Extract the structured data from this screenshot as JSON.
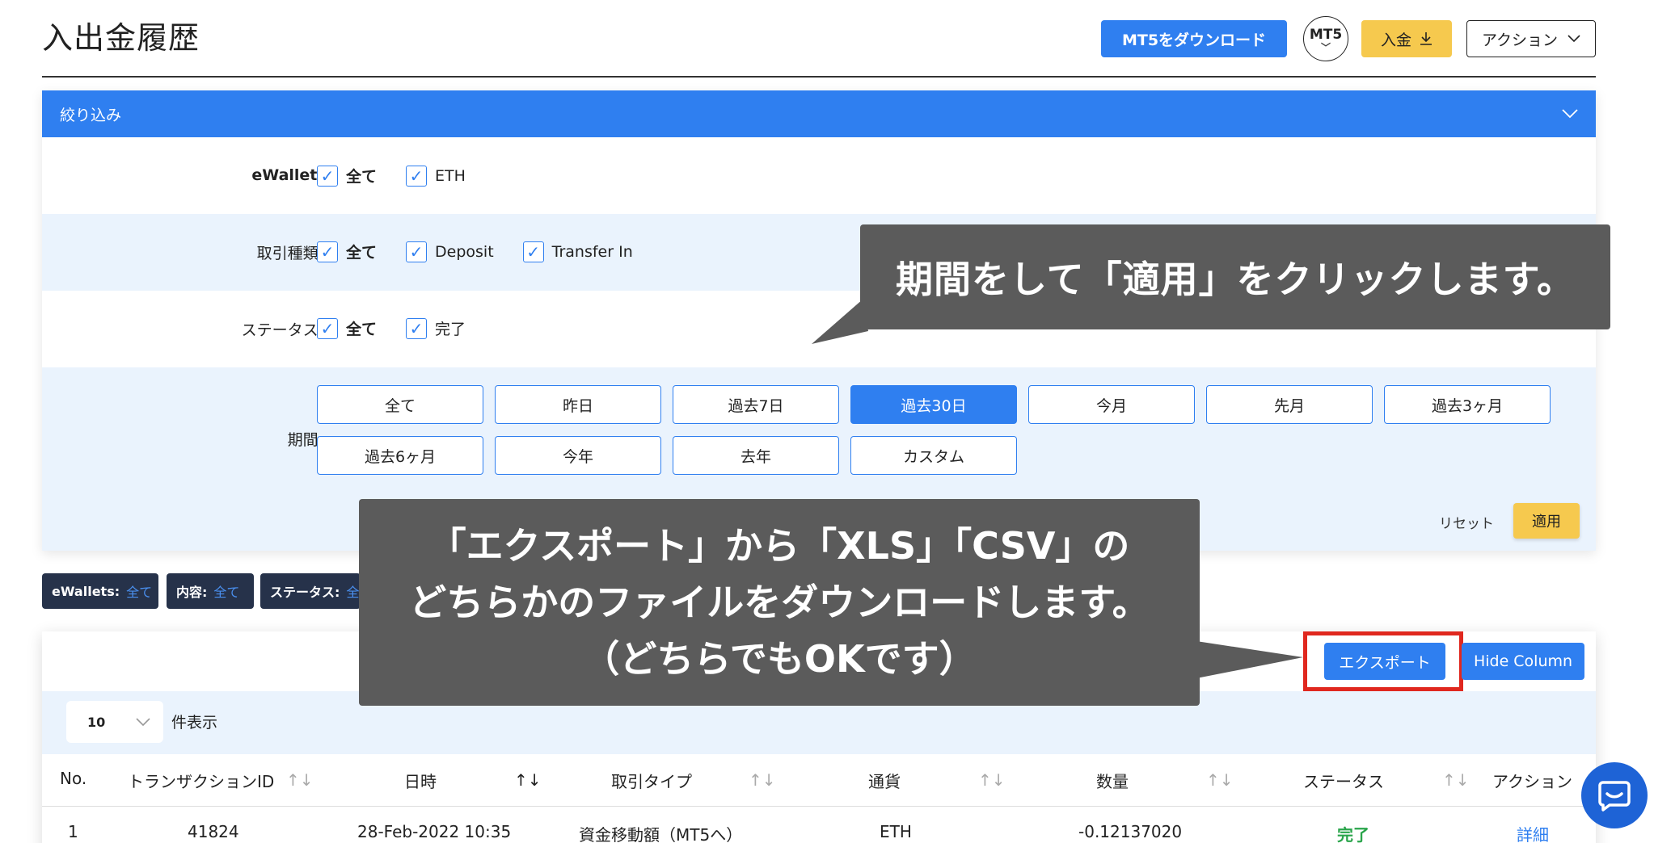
{
  "header": {
    "title": "入出金履歴",
    "mt5_download_label": "MT5をダウンロード",
    "mt5_badge": "MT5",
    "deposit_label": "入金",
    "action_label": "アクション"
  },
  "filter": {
    "heading": "絞り込み",
    "rows": {
      "ewallet": {
        "label": "eWallet:",
        "options": [
          "全て",
          "ETH"
        ]
      },
      "tx_type": {
        "label": "取引種類:",
        "options": [
          "全て",
          "Deposit",
          "Transfer In"
        ]
      },
      "status": {
        "label": "ステータス:",
        "options": [
          "全て",
          "完了"
        ]
      },
      "period": {
        "label": "期間:",
        "buttons": [
          "全て",
          "昨日",
          "過去7日",
          "過去30日",
          "今月",
          "先月",
          "過去3ヶ月",
          "過去6ヶ月",
          "今年",
          "去年",
          "カスタム"
        ],
        "selected": "過去30日"
      }
    },
    "reset_label": "リセット",
    "apply_label": "適用"
  },
  "chips": [
    {
      "key": "eWallets:",
      "value": "全て"
    },
    {
      "key": "内容:",
      "value": "全て"
    },
    {
      "key": "ステータス:",
      "value": "全"
    }
  ],
  "table": {
    "export_label": "エクスポート",
    "hide_column_label": "Hide Column",
    "page_length": "10",
    "page_length_label": "件表示",
    "columns": [
      "No.",
      "トランザクションID",
      "日時",
      "取引タイプ",
      "通貨",
      "数量",
      "ステータス",
      "アクション"
    ],
    "rows": [
      {
        "no": "1",
        "id": "41824",
        "date": "28-Feb-2022 10:35",
        "type": "資金移動額（MT5へ）",
        "currency": "ETH",
        "amount": "-0.12137020",
        "status": "完了",
        "action": "詳細"
      }
    ]
  },
  "annotations": {
    "callout1": "期間をして「適用」をクリックします。",
    "callout2_lines": [
      "「エクスポート」から「XLS」「CSV」の",
      "どちらかのファイルをダウンロードします。",
      "（どちらでもOKです）"
    ]
  },
  "colors": {
    "primary": "#2f7ff0",
    "accent_yellow": "#f6c94e",
    "callout_bg": "#5b5b5b",
    "highlight_red": "#e0281f",
    "status_green": "#2aa54b"
  }
}
